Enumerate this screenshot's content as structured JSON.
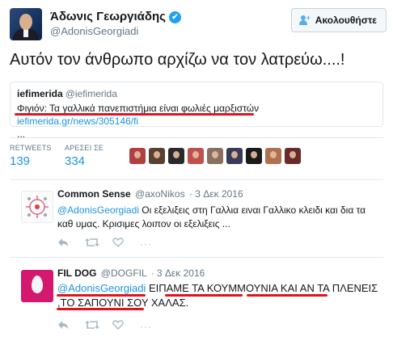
{
  "header": {
    "name": "Άδωνις Γεωργιάδης",
    "handle": "@AdonisGeorgiadi",
    "follow_label": "Ακολουθήστε"
  },
  "tweet": {
    "text": "Αυτόν τον άνθρωπο αρχίζω να τον λατρεύω....!"
  },
  "card": {
    "source_name": "iefimerida",
    "source_handle": "@iefimerida",
    "headline": "Φιγιόν: Τα γαλλικά πανεπιστήμια είναι φωλιές μαρξιστών",
    "link": "iefimerida.gr/news/305146/fi",
    "ellipsis": "..."
  },
  "stats": {
    "retweets_label": "RETWEETS",
    "retweets_value": "139",
    "likes_label": "ΑΡΕΣΕΙ ΣΕ",
    "likes_value": "334"
  },
  "likers": [
    {
      "icon": "liker-avatar-1",
      "color": "#b04040"
    },
    {
      "icon": "liker-avatar-2",
      "color": "#5a4030"
    },
    {
      "icon": "liker-avatar-3",
      "color": "#2a2a2a"
    },
    {
      "icon": "liker-avatar-4",
      "color": "#c05050"
    },
    {
      "icon": "liker-avatar-5",
      "color": "#8a7060"
    },
    {
      "icon": "liker-avatar-6",
      "color": "#3a3a5a"
    },
    {
      "icon": "liker-avatar-7",
      "color": "#1a1a1a"
    },
    {
      "icon": "liker-avatar-8",
      "color": "#b07050"
    },
    {
      "icon": "liker-avatar-9",
      "color": "#6a2a2a"
    }
  ],
  "replies": [
    {
      "name": "Common Sense",
      "handle": "@axoNikos",
      "date": "· 3 Δεκ 2016",
      "mention": "@AdonisGeorgiadi",
      "text": " Οι εξελιξεις στη Γαλλια ειναι Γαλλικο κλειδι και δια τα καθ υμας. Κρισιμες λοιπον οι εξελιξεις ..."
    },
    {
      "name": "FIL DOG",
      "handle": "@DOGFIL",
      "date": "· 3 Δεκ 2016",
      "mention": "@AdonisGeorgiadi",
      "text": " ΕΙΠΑΜΕ ΤΑ ΚΟΥΜΜΟΥΝΙΑ ΚΑΙ ΑΝ ΤΑ ΠΛΕΝΕΙΣ ,ΤΟ ΣΑΠΟΥΝΙ ΣΟΥ ΧΑΛΑΣ."
    }
  ],
  "colors": {
    "link": "#1b95e0",
    "underline": "#e0141e",
    "egg_bg": "#d4176f"
  }
}
